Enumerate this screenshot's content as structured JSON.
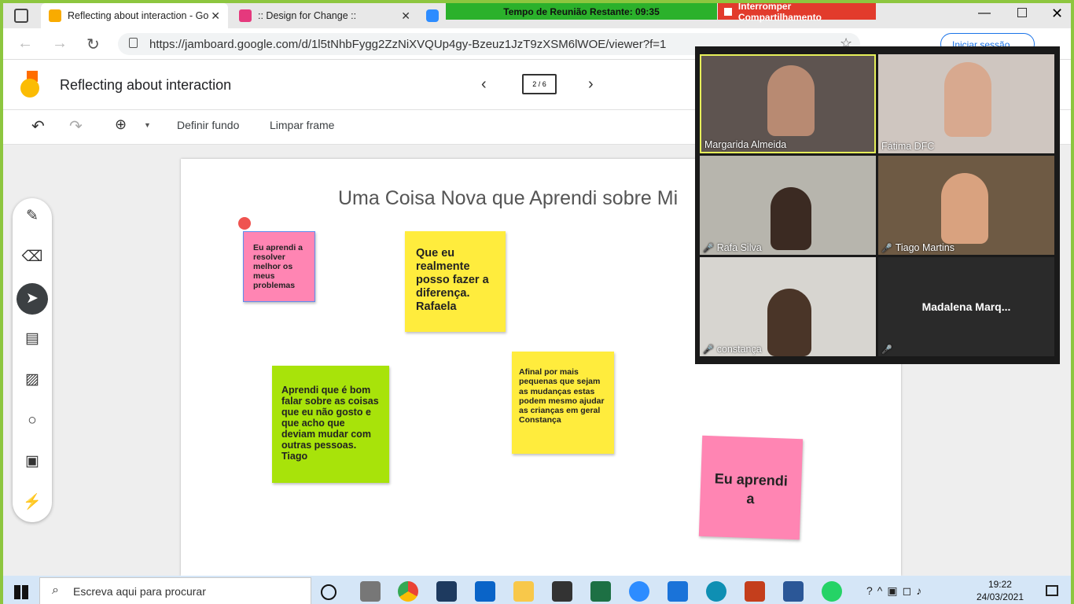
{
  "browser": {
    "tabs": [
      {
        "title": "Reflecting about interaction - Go",
        "active": true,
        "icon": "jamboard-icon"
      },
      {
        "title": ":: Design for Change ::",
        "active": false,
        "icon": "design-for-change-icon"
      }
    ],
    "url": "https://jamboard.google.com/d/1l5tNhbFygg2ZzNiXVQUp4gy-Bzeuz1JzT9zXSM6lWOE/viewer?f=1",
    "sign_in_label": "Iniciar sessão"
  },
  "meeting": {
    "time_remaining": "Tempo de Reunião Restante: 09:35",
    "stop_share": "Interromper Compartilhamento",
    "participants": [
      {
        "name": "Margarida Almeida",
        "muted": false,
        "active_speaker": true
      },
      {
        "name": "Fátima DFC",
        "muted": false
      },
      {
        "name": "Rafa Silva",
        "muted": true
      },
      {
        "name": "Tiago Martins",
        "muted": true
      },
      {
        "name": "constança",
        "muted": true
      },
      {
        "name": "Madalena  Marq...",
        "muted": true
      }
    ]
  },
  "jamboard": {
    "title": "Reflecting about interaction",
    "frame_indicator": "2 / 6",
    "toolbar": {
      "set_background": "Definir fundo",
      "clear_frame": "Limpar frame"
    },
    "frame_title": "Uma Coisa Nova que Aprendi sobre Mi",
    "notes": [
      {
        "text": "Eu aprendi a resolver melhor os meus problemas",
        "color": "#ff85b3"
      },
      {
        "text": "Que eu realmente posso fazer a diferença. Rafaela",
        "color": "#ffec3d"
      },
      {
        "text": "Aprendi que é bom falar sobre as coisas que eu não gosto e que acho que deviam mudar com outras pessoas. Tiago",
        "color": "#a8e30a"
      },
      {
        "text": "Afinal por mais pequenas que sejam as mudanças estas podem mesmo ajudar as crianças em geral Constança",
        "color": "#ffec3d"
      },
      {
        "text": "Eu aprendi a",
        "color": "#ff85b3"
      }
    ]
  },
  "taskbar": {
    "search_placeholder": "Escreva aqui para procurar",
    "time": "19:22",
    "date": "24/03/2021"
  }
}
